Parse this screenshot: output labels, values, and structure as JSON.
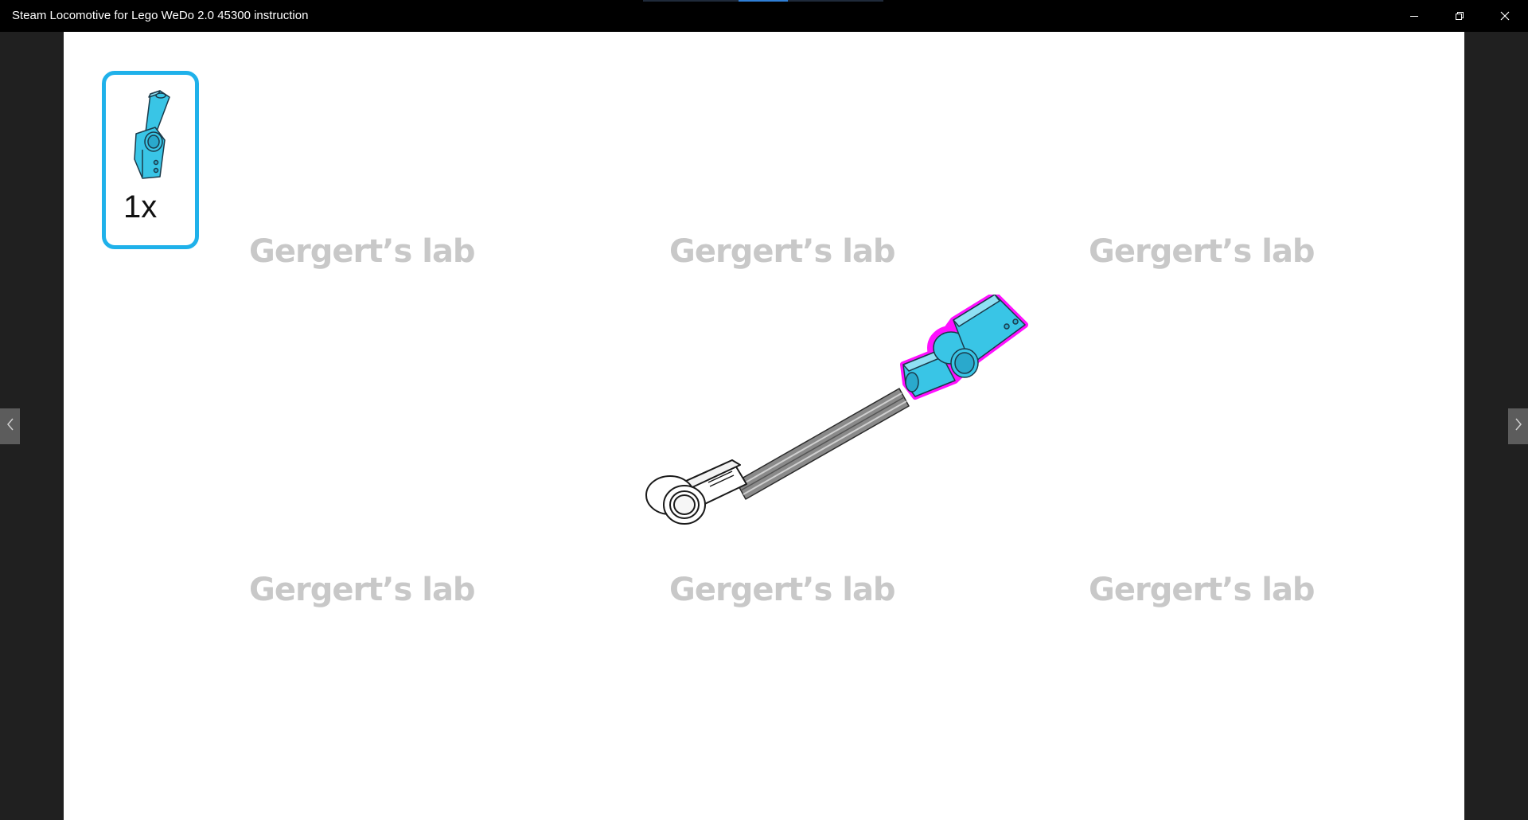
{
  "window": {
    "title": "Steam Locomotive for Lego WeDo 2.0 45300 instruction",
    "controls": {
      "minimize_icon": "minimize-icon",
      "restore_icon": "restore-icon",
      "close_icon": "close-icon"
    }
  },
  "viewer": {
    "prev_icon": "chevron-left-icon",
    "next_icon": "chevron-right-icon"
  },
  "page": {
    "parts_list": {
      "items": [
        {
          "part_icon": "blue-angle-connector-icon",
          "quantity": "1x"
        }
      ],
      "border_color": "#1fb1ea"
    },
    "watermarks": [
      "Gergert’s lab",
      "Gergert’s lab",
      "Gergert’s lab",
      "Gergert’s lab",
      "Gergert’s lab",
      "Gergert’s lab"
    ],
    "assembly": {
      "parts": [
        "white-beam-connector",
        "gray-axle",
        "blue-angle-connector"
      ],
      "highlight_color": "#ff00ff",
      "part_color": "#39c5e6"
    }
  }
}
